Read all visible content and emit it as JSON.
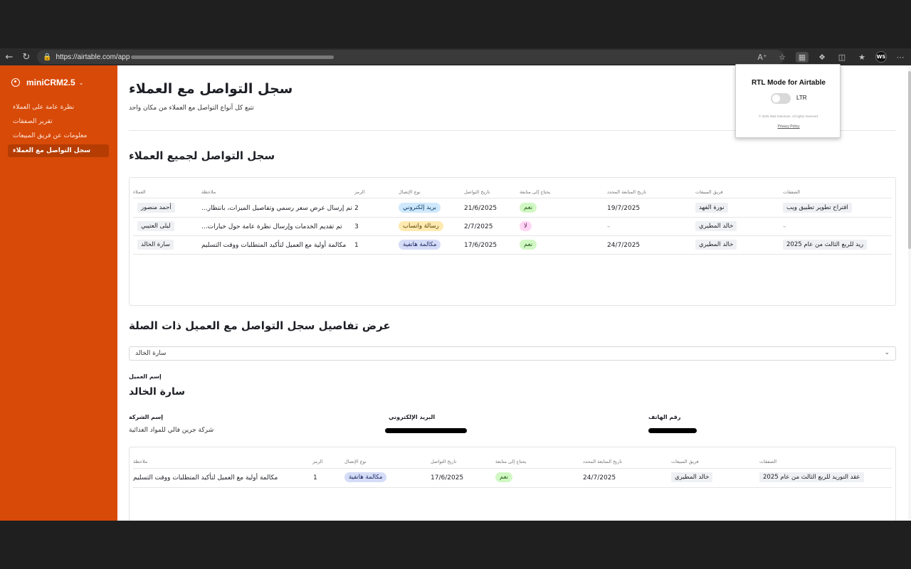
{
  "browser": {
    "url": "https://airtable.com/app",
    "icons": [
      "back-icon",
      "reload-icon",
      "lock-icon",
      "read-aloud-icon",
      "favorite-star-icon",
      "extension-icon",
      "extensions-puzzle-icon",
      "split-screen-icon",
      "favorites-icon",
      "profile-avatar",
      "more-menu-icon"
    ],
    "profile_initials": "WS"
  },
  "sidebar": {
    "brand": "miniCRM2.5",
    "items": [
      {
        "label": "نظرة عامة على العملاء"
      },
      {
        "label": "تقرير الصفقات"
      },
      {
        "label": "معلومات عن فريق المبيعات"
      },
      {
        "label": "سجل التواصل مع العملاء"
      }
    ],
    "colors": {
      "background": "#d84a08",
      "active": "#b53d04"
    }
  },
  "page": {
    "title": "سجل التواصل مع العملاء",
    "subtitle": "تتبع كل أنواع التواصل مع العملاء من مكان واحد"
  },
  "all_log": {
    "title": "سجل التواصل لجميع العملاء",
    "headers": {
      "client": "العملاء",
      "note": "ملاحظة",
      "code": "الرمز",
      "contact_type": "نوع الإتصال",
      "contact_date": "تاريخ التواصل",
      "needs_followup": "يحتاج إلى متابعة",
      "followup_date": "تاريخ المتابعة المحدد",
      "sales_team": "فريق المبيعات",
      "deals": "الصفقات"
    },
    "rows": [
      {
        "client": "أحمد منصور",
        "note": "...تم إرسال عرض سعر رسمي وتفاصيل الميزات، بانتظار",
        "code": "2",
        "contact_type": "بريد إلكتروني",
        "contact_date": "21/6/2025",
        "needs_followup": "نعم",
        "followup_date": "19/7/2025",
        "sales_team": "نورة الفهد",
        "deals": "اقتراح تطوير تطبيق ويب"
      },
      {
        "client": "ليلى العتيبي",
        "note": "...تم تقديم الخدمات وإرسال نظرة عامة حول خيارات",
        "code": "3",
        "contact_type": "رسالة واتساب",
        "contact_date": "2/7/2025",
        "needs_followup": "لا",
        "followup_date": "–",
        "sales_team": "خالد المطيري",
        "deals": "–"
      },
      {
        "client": "سارة الخالد",
        "note": "مكالمة أولية مع العميل لتأكيد المتطلبات ووقت التسليم",
        "code": "1",
        "contact_type": "مكالمة هاتفية",
        "contact_date": "17/6/2025",
        "needs_followup": "نعم",
        "followup_date": "24/7/2025",
        "sales_team": "خالد المطيري",
        "deals": "ريد للربع الثالث من عام 2025"
      }
    ]
  },
  "details": {
    "title": "عرض تفاصيل سجل التواصل مع العميل ذات الصلة",
    "select_value": "سارة الخالد",
    "client_label": "إسم العميل",
    "client_name": "سارة الخالد",
    "company_label": "إسم الشركة",
    "company_value": "شركة جرين فالي للمواد الغذائية",
    "email_label": "البريد الإلكتروني",
    "phone_label": "رقم الهاتف",
    "headers": {
      "note": "ملاحظة",
      "code": "الرمز",
      "contact_type": "نوع الإتصال",
      "contact_date": "تاريخ التواصل",
      "needs_followup": "يحتاج إلى متابعة",
      "followup_date": "تاريخ المتابعة المحدد",
      "sales_team": "فريق المبيعات",
      "deals": "الصفقات"
    },
    "row": {
      "note": "مكالمة أولية مع العميل لتأكيد المتطلبات ووقت التسليم",
      "code": "1",
      "contact_type": "مكالمة هاتفية",
      "contact_date": "17/6/2025",
      "needs_followup": "نعم",
      "followup_date": "24/7/2025",
      "sales_team": "خالد المطيري",
      "deals": "عقد التوريد للربع الثالث من عام 2025"
    }
  },
  "popup": {
    "title": "RTL Mode for Airtable",
    "toggle_label": "LTR",
    "copyright": "© 2025 Wail Soleiman. All rights reserved.",
    "privacy_link": "Privacy Policy"
  }
}
